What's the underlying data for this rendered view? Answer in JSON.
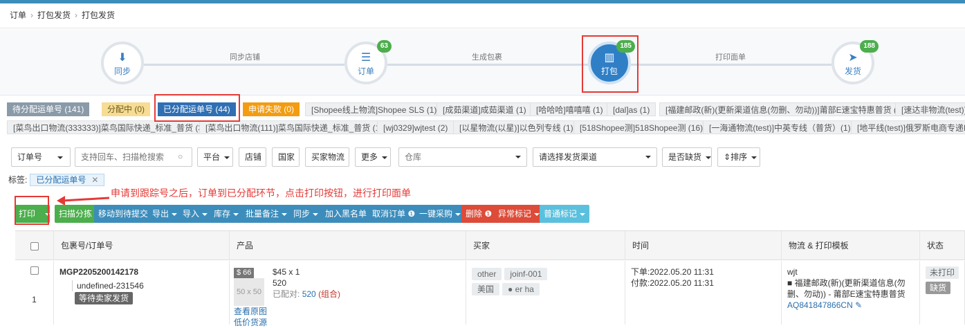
{
  "breadcrumb": [
    "订单",
    "打包发货",
    "打包发货"
  ],
  "steps": [
    {
      "label": "同步",
      "badge": ""
    },
    {
      "label": "订单",
      "badge": "63"
    },
    {
      "label": "打包",
      "badge": "185"
    },
    {
      "label": "发货",
      "badge": "188"
    }
  ],
  "step_connectors": [
    "同步店铺",
    "生成包裹",
    "打印面单"
  ],
  "status_tabs": [
    "待分配运单号 (141)",
    "分配中 (0)",
    "已分配运单号 (44)",
    "申请失败 (0)"
  ],
  "channel_tabs_row1": [
    "[Shopee线上物流]Shopee SLS (1)",
    "[成茹渠道]成茹渠道 (1)",
    "[哈哈哈]嘻嘻嘻 (1)",
    "[dal]as (1)",
    "[福建邮政(新)(更新渠道信息(勿删、勿动))]莆部E速宝特惠普货 (12)",
    "[速达非物流(test)]快"
  ],
  "channel_tabs_row2": [
    "[菜鸟出口物流(333333)]菜鸟国际快递_标准_普货 (3)",
    "[菜鸟出口物流(111)]菜鸟国际快递_标准_普货 (1)",
    "[wj0329]wjtest (2)",
    "[以星物流(以星)]以色列专线 (1)",
    "[518Shopee测]518Shopee测 (16)",
    "[一海通物流(test)]中英专线（普货）(1)",
    "[地平线(test)]俄罗斯电商专递B (2"
  ],
  "filters": {
    "order_no": "订单号",
    "search_placeholder": "支持回车、扫描枪搜索",
    "platform": "平台",
    "store": "店铺",
    "country": "国家",
    "buyer_logistics": "买家物流",
    "more": "更多",
    "warehouse_placeholder": "仓库",
    "channel_placeholder": "请选择发货渠道",
    "out_of_stock": "是否缺货",
    "sort": "排序"
  },
  "tag_label": "标签:",
  "tag_value": "已分配运单号",
  "annotation": "申请到跟踪号之后，订单到已分配环节，点击打印按钮，进行打印面单",
  "buttons": [
    "打印",
    "扫描分拣",
    "移动到待提交",
    "导出",
    "导入",
    "库存",
    "批量备注",
    "同步",
    "加入黑名单",
    "取消订单",
    "一键采购",
    "删除",
    "异常标记",
    "普通标记"
  ],
  "columns": [
    "包裹号/订单号",
    "产品",
    "买家",
    "时间",
    "物流 & 打印模板",
    "状态"
  ],
  "row": {
    "package_no": "MGP2205200142178",
    "order_no": "undefined-231546",
    "pending": "等待卖家发货",
    "index": "1",
    "price_badge": "$ 66",
    "img_size": "50 x 50",
    "unit_price": "$45 x 1",
    "sku": "520",
    "matched_label": "已配对:",
    "matched_value": "520",
    "matched_combo": "(组合)",
    "view_image": "查看原图",
    "low_price": "低价货源",
    "buyer_tags": [
      "other",
      "joinf-001"
    ],
    "country": "美国",
    "buyer_name": "er ha",
    "order_time": "下单:2022.05.20 11:31",
    "pay_time": "付款:2022.05.20 11:31",
    "logistics_user": "wjt",
    "logistics_channel": "福建邮政(新)(更新渠道信息(勿删、勿动)) - 莆部E速宝特惠普货",
    "tracking": "AQ841847866CN",
    "status_print": "未打印",
    "status_stock": "缺货"
  }
}
